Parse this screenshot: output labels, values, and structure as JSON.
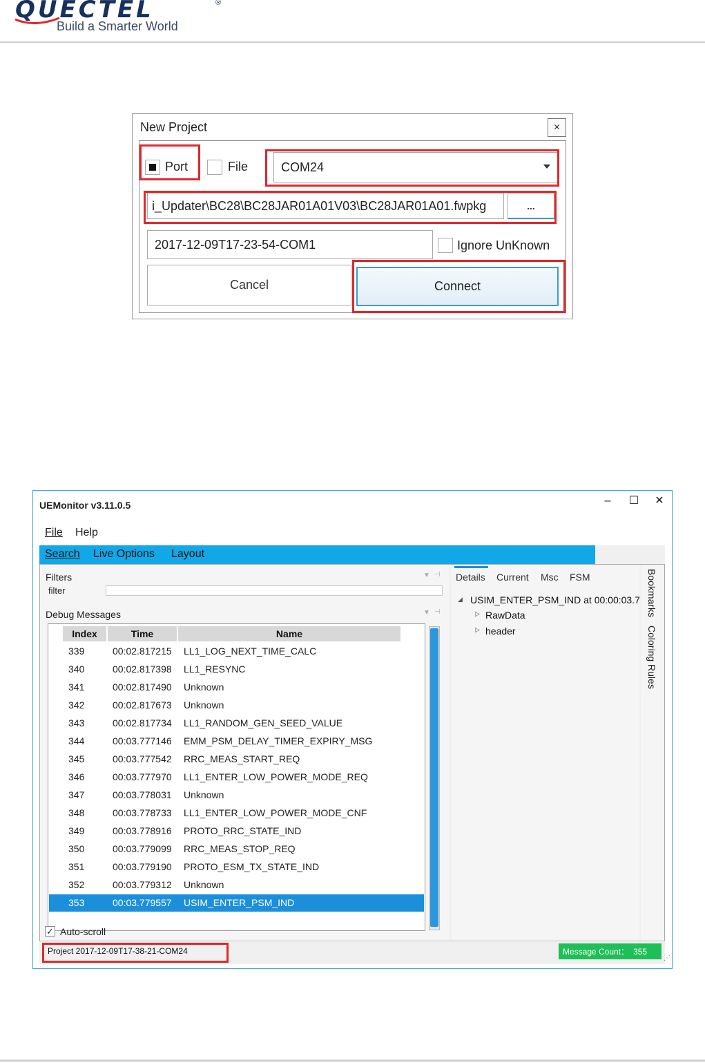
{
  "brand": {
    "logo_text": "QUECTEL",
    "registered_mark": "®",
    "tagline": "Build a Smarter World",
    "color": "#17315f"
  },
  "new_project_dialog": {
    "title": "New Project",
    "close_icon": "close-icon",
    "port_label": "Port",
    "port_checked": true,
    "file_label": "File",
    "file_checked": false,
    "port_select_value": "COM24",
    "firmware_path": "і_Updater\\BC28\\BC28JAR01A01V03\\BC28JAR01A01.fwpkg",
    "browse_label": "...",
    "project_name": "2017-12-09T17-23-54-COM1",
    "ignore_unknown_label": "Ignore UnKnown",
    "ignore_unknown_checked": false,
    "cancel_label": "Cancel",
    "connect_label": "Connect",
    "highlight_color": "#e3262b"
  },
  "uemonitor": {
    "title": "UEMonitor v3.11.0.5",
    "window_controls": {
      "minimize": "–",
      "maximize": "☐",
      "close": "✕"
    },
    "menu": {
      "file": "File",
      "help": "Help"
    },
    "ribbon": {
      "search": "Search",
      "live_options": "Live Options",
      "layout": "Layout",
      "color": "#12a8e8"
    },
    "filters_label": "Filters",
    "filter_field_label": "filter",
    "filter_value": "",
    "debug_messages_label": "Debug Messages",
    "columns": {
      "index": "Index",
      "time": "Time",
      "name": "Name"
    },
    "rows": [
      {
        "index": "339",
        "time": "00:02.817215",
        "name": "LL1_LOG_NEXT_TIME_CALC"
      },
      {
        "index": "340",
        "time": "00:02.817398",
        "name": "LL1_RESYNC"
      },
      {
        "index": "341",
        "time": "00:02.817490",
        "name": "Unknown"
      },
      {
        "index": "342",
        "time": "00:02.817673",
        "name": "Unknown"
      },
      {
        "index": "343",
        "time": "00:02.817734",
        "name": "LL1_RANDOM_GEN_SEED_VALUE"
      },
      {
        "index": "344",
        "time": "00:03.777146",
        "name": "EMM_PSM_DELAY_TIMER_EXPIRY_MSG"
      },
      {
        "index": "345",
        "time": "00:03.777542",
        "name": "RRC_MEAS_START_REQ"
      },
      {
        "index": "346",
        "time": "00:03.777970",
        "name": "LL1_ENTER_LOW_POWER_MODE_REQ"
      },
      {
        "index": "347",
        "time": "00:03.778031",
        "name": "Unknown"
      },
      {
        "index": "348",
        "time": "00:03.778733",
        "name": "LL1_ENTER_LOW_POWER_MODE_CNF"
      },
      {
        "index": "349",
        "time": "00:03.778916",
        "name": "PROTO_RRC_STATE_IND"
      },
      {
        "index": "350",
        "time": "00:03.779099",
        "name": "RRC_MEAS_STOP_REQ"
      },
      {
        "index": "351",
        "time": "00:03.779190",
        "name": "PROTO_ESM_TX_STATE_IND"
      },
      {
        "index": "352",
        "time": "00:03.779312",
        "name": "Unknown"
      },
      {
        "index": "353",
        "time": "00:03.779557",
        "name": "USIM_ENTER_PSM_IND",
        "selected": true
      }
    ],
    "auto_scroll_label": "Auto-scroll",
    "auto_scroll_checked": true,
    "details_tabs": [
      "Details",
      "Current",
      "Msc",
      "FSM"
    ],
    "active_tab": "Details",
    "tree": {
      "root": "USIM_ENTER_PSM_IND at 00:00:03.7",
      "children": [
        "RawData",
        "header"
      ]
    },
    "side_tabs": [
      "Bookmarks",
      "Coloring Rules"
    ],
    "status_project": "Project 2017-12-09T17-38-21-COM24",
    "message_count_label": "Message Count：",
    "message_count": "355",
    "message_count_color": "#1fbf57",
    "selection_color": "#1c8fdb"
  }
}
